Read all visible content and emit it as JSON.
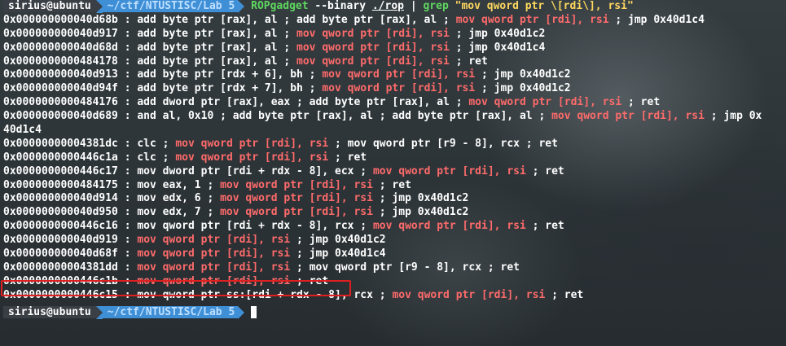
{
  "prompt": {
    "user": "sirius@ubuntu",
    "path": "~/ctf/NTUSTISC/Lab 5",
    "command": "ROPgadget",
    "args": "--binary",
    "file": "./rop",
    "pipe": "|",
    "grep": "grep",
    "pattern": "\"mov qword ptr \\[rdi\\], rsi\""
  },
  "lines": [
    [
      {
        "t": "0x000000000040d68b : add byte ptr [rax], al ; add byte ptr [rax], al ; "
      },
      {
        "t": "mov qword ptr [rdi], rsi",
        "h": true
      },
      {
        "t": " ; jmp 0x40d1c4"
      }
    ],
    [
      {
        "t": "0x000000000040d917 : add byte ptr [rax], al ; "
      },
      {
        "t": "mov qword ptr [rdi], rsi",
        "h": true
      },
      {
        "t": " ; jmp 0x40d1c2"
      }
    ],
    [
      {
        "t": "0x000000000040d68d : add byte ptr [rax], al ; "
      },
      {
        "t": "mov qword ptr [rdi], rsi",
        "h": true
      },
      {
        "t": " ; jmp 0x40d1c4"
      }
    ],
    [
      {
        "t": "0x0000000000484178 : add byte ptr [rax], al ; "
      },
      {
        "t": "mov qword ptr [rdi], rsi",
        "h": true
      },
      {
        "t": " ; ret"
      }
    ],
    [
      {
        "t": "0x000000000040d913 : add byte ptr [rdx + 6], bh ; "
      },
      {
        "t": "mov qword ptr [rdi], rsi",
        "h": true
      },
      {
        "t": " ; jmp 0x40d1c2"
      }
    ],
    [
      {
        "t": "0x000000000040d94f : add byte ptr [rdx + 7], bh ; "
      },
      {
        "t": "mov qword ptr [rdi], rsi",
        "h": true
      },
      {
        "t": " ; jmp 0x40d1c2"
      }
    ],
    [
      {
        "t": "0x0000000000484176 : add dword ptr [rax], eax ; add byte ptr [rax], al ; "
      },
      {
        "t": "mov qword ptr [rdi], rsi",
        "h": true
      },
      {
        "t": " ; ret"
      }
    ],
    [
      {
        "t": "0x000000000040d689 : and al, 0x10 ; add byte ptr [rax], al ; add byte ptr [rax], al ; "
      },
      {
        "t": "mov qword ptr [rdi], rsi",
        "h": true
      },
      {
        "t": " ; jmp 0x"
      }
    ],
    [
      {
        "t": "40d1c4"
      }
    ],
    [
      {
        "t": "0x00000000004381dc : clc ; "
      },
      {
        "t": "mov qword ptr [rdi], rsi",
        "h": true
      },
      {
        "t": " ; mov qword ptr [r9 - 8], rcx ; ret"
      }
    ],
    [
      {
        "t": "0x0000000000446c1a : clc ; "
      },
      {
        "t": "mov qword ptr [rdi], rsi",
        "h": true
      },
      {
        "t": " ; ret"
      }
    ],
    [
      {
        "t": "0x0000000000446c17 : mov dword ptr [rdi + rdx - 8], ecx ; "
      },
      {
        "t": "mov qword ptr [rdi], rsi",
        "h": true
      },
      {
        "t": " ; ret"
      }
    ],
    [
      {
        "t": "0x0000000000484175 : mov eax, 1 ; "
      },
      {
        "t": "mov qword ptr [rdi], rsi",
        "h": true
      },
      {
        "t": " ; ret"
      }
    ],
    [
      {
        "t": "0x000000000040d914 : mov edx, 6 ; "
      },
      {
        "t": "mov qword ptr [rdi], rsi",
        "h": true
      },
      {
        "t": " ; jmp 0x40d1c2"
      }
    ],
    [
      {
        "t": "0x000000000040d950 : mov edx, 7 ; "
      },
      {
        "t": "mov qword ptr [rdi], rsi",
        "h": true
      },
      {
        "t": " ; jmp 0x40d1c2"
      }
    ],
    [
      {
        "t": "0x0000000000446c16 : mov qword ptr [rdi + rdx - 8], rcx ; "
      },
      {
        "t": "mov qword ptr [rdi], rsi",
        "h": true
      },
      {
        "t": " ; ret"
      }
    ],
    [
      {
        "t": "0x000000000040d919 : "
      },
      {
        "t": "mov qword ptr [rdi], rsi",
        "h": true
      },
      {
        "t": " ; jmp 0x40d1c2"
      }
    ],
    [
      {
        "t": "0x000000000040d68f : "
      },
      {
        "t": "mov qword ptr [rdi], rsi",
        "h": true
      },
      {
        "t": " ; jmp 0x40d1c4"
      }
    ],
    [
      {
        "t": "0x00000000004381dd : "
      },
      {
        "t": "mov qword ptr [rdi], rsi",
        "h": true
      },
      {
        "t": " ; mov qword ptr [r9 - 8], rcx ; ret"
      }
    ],
    [
      {
        "t": "0x0000000000446c1b : "
      },
      {
        "t": "mov qword ptr [rdi], rsi",
        "h": true
      },
      {
        "t": " ; ret"
      }
    ],
    [
      {
        "t": "0x0000000000446c15 : mov qword ptr ss:[rdi + rdx - 8], rcx ; "
      },
      {
        "t": "mov qword ptr [rdi], rsi",
        "h": true
      },
      {
        "t": " ; ret"
      }
    ]
  ],
  "colors": {
    "highlight": "#ff6b6b",
    "command": "#5fd75f",
    "string": "#ffd75f",
    "path_bg": "#3f8fd6",
    "annotation_box": "#e02020"
  }
}
